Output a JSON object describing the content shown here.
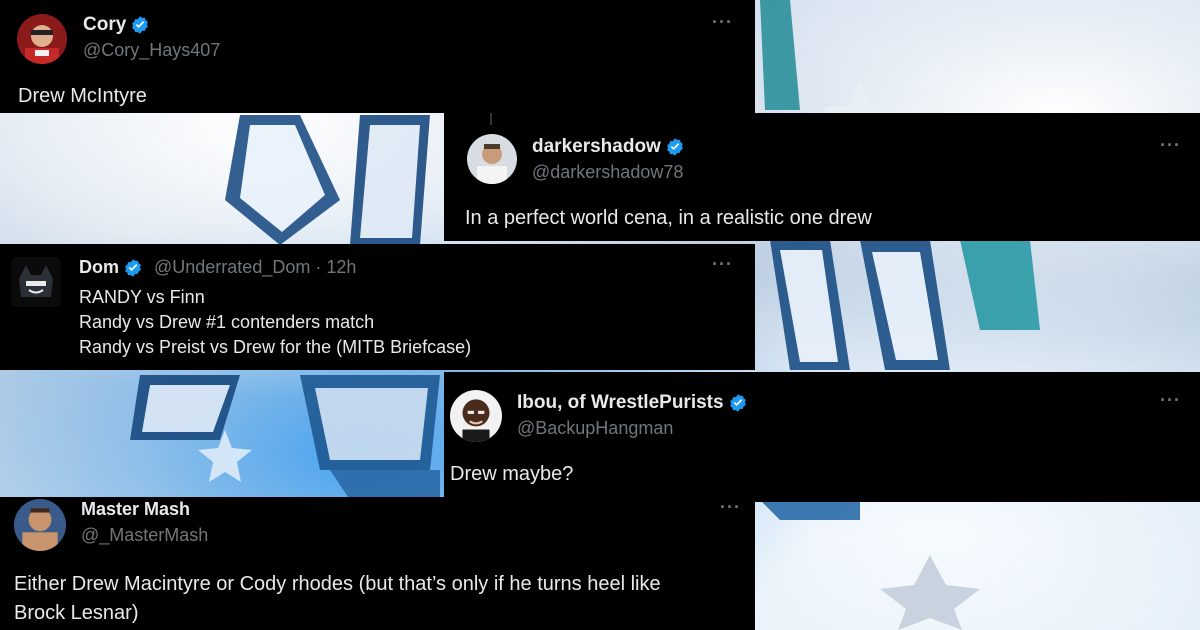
{
  "tweets": [
    {
      "name": "Cory",
      "handle": "@Cory_Hays407",
      "verified": true,
      "text": "Drew McIntyre",
      "more": "···"
    },
    {
      "name": "darkershadow",
      "handle": "@darkershadow78",
      "verified": true,
      "text": "In a perfect world cena, in a realistic one drew",
      "more": "···"
    },
    {
      "name": "Dom",
      "handle": "@Underrated_Dom · 12h",
      "verified": true,
      "lines": [
        "RANDY vs Finn",
        "Randy vs Drew #1 contenders match",
        "Randy vs Preist vs Drew for the (MITB Briefcase)"
      ],
      "more": "···"
    },
    {
      "name": "Ibou, of WrestlePurists",
      "handle": "@BackupHangman",
      "verified": true,
      "text": "Drew maybe?",
      "more": "···"
    },
    {
      "name": "Master Mash",
      "handle": "@_MasterMash",
      "verified": false,
      "lines": [
        "Either Drew Macintyre or Cody rhodes (but that’s only if he turns heel like",
        "Brock Lesnar)"
      ],
      "more": "···"
    }
  ],
  "colors": {
    "card_bg": "#000000",
    "name": "#e7e9ea",
    "handle": "#71767b",
    "verified_badge": "#1d9bf0"
  },
  "icons": {
    "verified": "verified-badge-icon",
    "more": "more-options-icon"
  }
}
